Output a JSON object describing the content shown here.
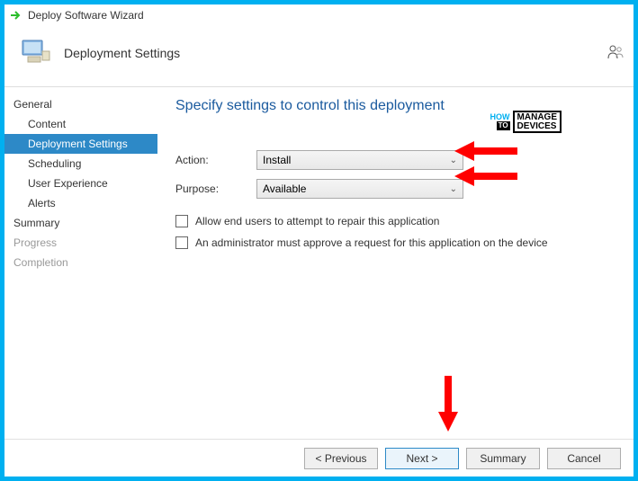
{
  "window": {
    "title": "Deploy Software Wizard"
  },
  "header": {
    "title": "Deployment Settings"
  },
  "sidebar": {
    "groups": [
      {
        "label": "General",
        "dim": false
      },
      {
        "label": "Summary",
        "dim": false
      },
      {
        "label": "Progress",
        "dim": true
      },
      {
        "label": "Completion",
        "dim": true
      }
    ],
    "items": [
      {
        "label": "Content"
      },
      {
        "label": "Deployment Settings"
      },
      {
        "label": "Scheduling"
      },
      {
        "label": "User Experience"
      },
      {
        "label": "Alerts"
      }
    ]
  },
  "main": {
    "heading": "Specify settings to control this deployment",
    "action_label": "Action:",
    "action_value": "Install",
    "purpose_label": "Purpose:",
    "purpose_value": "Available",
    "checkbox1": "Allow end users to attempt to repair this application",
    "checkbox2": "An administrator must approve a request for this application on the device"
  },
  "watermark": {
    "how": "HOW",
    "to": "TO",
    "line1": "MANAGE",
    "line2": "DEVICES"
  },
  "footer": {
    "previous": "< Previous",
    "next": "Next >",
    "summary": "Summary",
    "cancel": "Cancel"
  }
}
